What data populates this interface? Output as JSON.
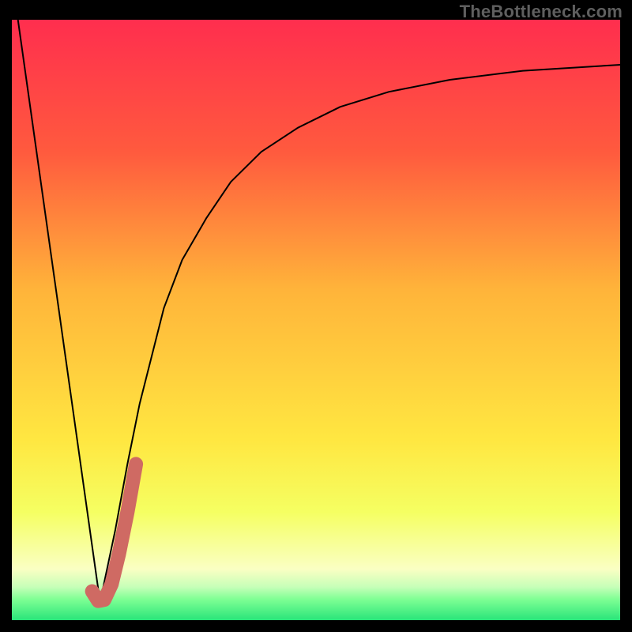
{
  "watermark": "TheBottleneck.com",
  "chart_data": {
    "type": "line",
    "title": "",
    "xlabel": "",
    "ylabel": "",
    "xlim": [
      0,
      100
    ],
    "ylim": [
      0,
      100
    ],
    "grid": false,
    "legend": false,
    "background_gradient_stops": [
      {
        "pos": 0.0,
        "color": "#ff2e4e"
      },
      {
        "pos": 0.22,
        "color": "#ff5a3e"
      },
      {
        "pos": 0.45,
        "color": "#ffb43a"
      },
      {
        "pos": 0.7,
        "color": "#ffe741"
      },
      {
        "pos": 0.82,
        "color": "#f5ff62"
      },
      {
        "pos": 0.915,
        "color": "#faffc3"
      },
      {
        "pos": 0.945,
        "color": "#c6ffb8"
      },
      {
        "pos": 0.965,
        "color": "#7fff94"
      },
      {
        "pos": 1.0,
        "color": "#29e57a"
      }
    ],
    "series": [
      {
        "name": "left-descent",
        "color": "#000000",
        "width": 2,
        "x": [
          1.0,
          14.5
        ],
        "y": [
          100,
          3
        ]
      },
      {
        "name": "right-curve",
        "color": "#000000",
        "width": 2,
        "x": [
          14.5,
          17,
          19,
          21,
          23,
          25,
          28,
          32,
          36,
          41,
          47,
          54,
          62,
          72,
          84,
          100
        ],
        "y": [
          3,
          15,
          26,
          36,
          44,
          52,
          60,
          67,
          73,
          78,
          82,
          85.5,
          88,
          90,
          91.5,
          92.5
        ]
      },
      {
        "name": "highlight-hook",
        "color": "#cf6a63",
        "width": 18,
        "linecap": "round",
        "x": [
          13.2,
          14.2,
          15.2,
          16.4,
          17.6,
          19.0,
          20.4
        ],
        "y": [
          4.8,
          3.2,
          3.4,
          6.0,
          11.0,
          18.0,
          26.0
        ]
      }
    ]
  }
}
